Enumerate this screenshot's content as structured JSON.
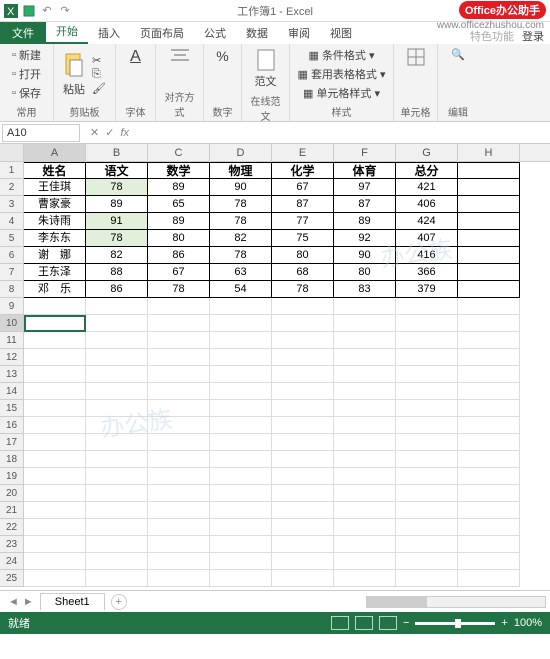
{
  "app": {
    "title": "工作簿1 - Excel"
  },
  "badge": {
    "brand": "Office",
    "text": "办公助手",
    "url": "www.officezhushou.com"
  },
  "tabs": {
    "file": "文件",
    "home": "开始",
    "insert": "插入",
    "layout": "页面布局",
    "formulas": "公式",
    "data": "数据",
    "review": "审阅",
    "view": "视图",
    "special": "特色功能",
    "login": "登录"
  },
  "ribbon": {
    "new": "新建",
    "open": "打开",
    "save": "保存",
    "freq": "常用",
    "paste": "粘贴",
    "clipboard": "剪贴板",
    "font": "字体",
    "align": "对齐方式",
    "number": "数字",
    "range": "范文",
    "online_range": "在线范文",
    "cond_fmt": "条件格式",
    "tbl_fmt": "套用表格格式",
    "cell_style": "单元格样式",
    "styles": "样式",
    "cells": "单元格",
    "editing": "编辑"
  },
  "namebox": {
    "ref": "A10",
    "fx": "fx"
  },
  "columns": [
    "A",
    "B",
    "C",
    "D",
    "E",
    "F",
    "G",
    "H"
  ],
  "table": {
    "headers": [
      "姓名",
      "语文",
      "数学",
      "物理",
      "化学",
      "体育",
      "总分"
    ],
    "rows": [
      {
        "name": "王佳琪",
        "vals": [
          "78",
          "89",
          "90",
          "67",
          "97",
          "421"
        ],
        "hl": 0
      },
      {
        "name": "曹家豪",
        "vals": [
          "89",
          "65",
          "78",
          "87",
          "87",
          "406"
        ]
      },
      {
        "name": "朱诗雨",
        "vals": [
          "91",
          "89",
          "78",
          "77",
          "89",
          "424"
        ],
        "hl": 0
      },
      {
        "name": "李东东",
        "vals": [
          "78",
          "80",
          "82",
          "75",
          "92",
          "407"
        ],
        "hl": 0
      },
      {
        "name": "谢　娜",
        "vals": [
          "82",
          "86",
          "78",
          "80",
          "90",
          "416"
        ]
      },
      {
        "name": "王东泽",
        "vals": [
          "88",
          "67",
          "63",
          "68",
          "80",
          "366"
        ]
      },
      {
        "name": "邓　乐",
        "vals": [
          "86",
          "78",
          "54",
          "78",
          "83",
          "379"
        ]
      }
    ]
  },
  "sheet_tabs": {
    "sheet1": "Sheet1"
  },
  "statusbar": {
    "ready": "就绪",
    "zoom": "100%"
  },
  "watermark": "办公族"
}
